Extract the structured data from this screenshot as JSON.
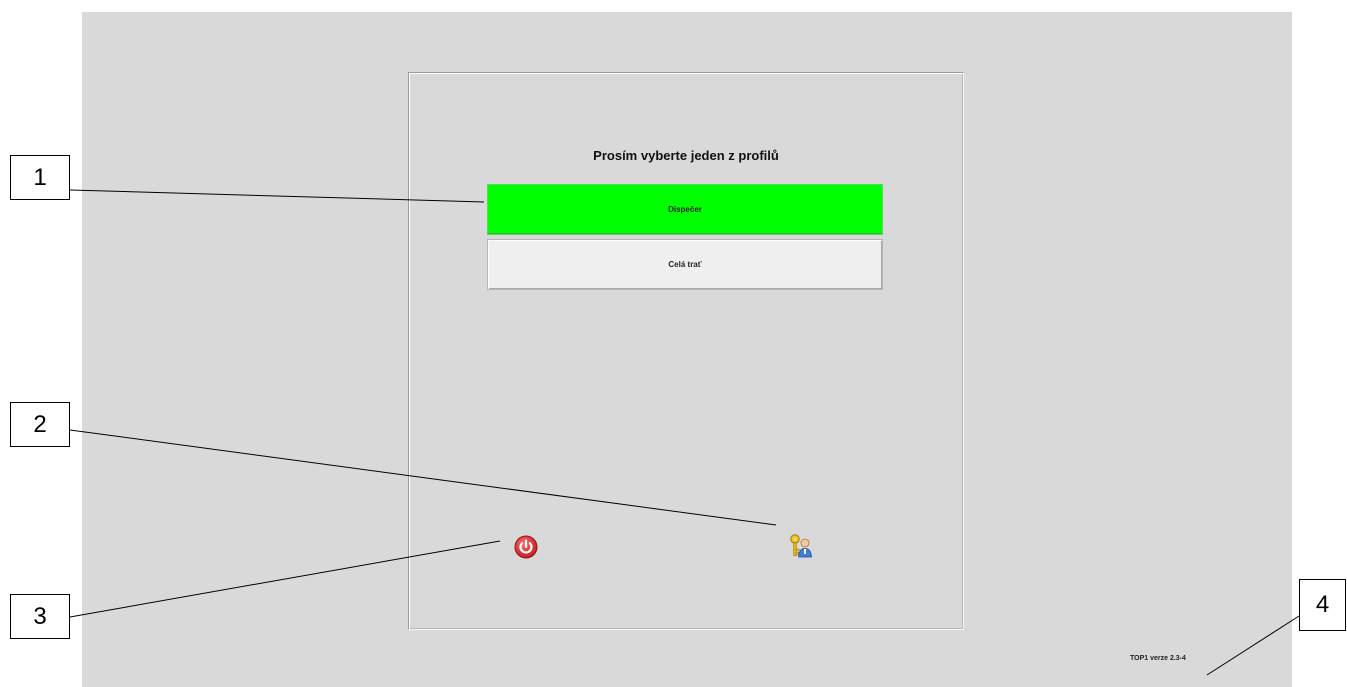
{
  "panel": {
    "title": "Prosím vyberte jeden z profilů",
    "profiles": [
      {
        "label": "Dispečer",
        "selected": true,
        "color": "#00ff00"
      },
      {
        "label": "Celá trať",
        "selected": false,
        "color": "#efefef"
      }
    ],
    "icons": {
      "power": "power-icon",
      "user_key": "user-key-icon"
    }
  },
  "version": "TOP1 verze 2.3-4",
  "callouts": [
    "1",
    "2",
    "3",
    "4"
  ],
  "colors": {
    "background": "#d9d9d9",
    "selected_profile": "#00ff00",
    "power_icon": "#d32f2f"
  }
}
